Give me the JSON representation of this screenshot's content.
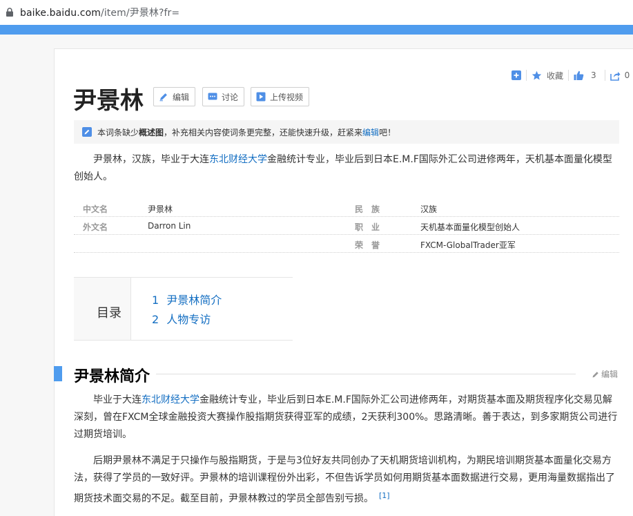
{
  "browser": {
    "url_host": "baike.baidu.com",
    "url_path": "/item/尹景林?fr="
  },
  "toolbar": {
    "collect_label": "收藏",
    "like_count": "3",
    "share_count": "0"
  },
  "title": {
    "name": "尹景林",
    "edit_label": "编辑",
    "discuss_label": "讨论",
    "upload_label": "上传视频"
  },
  "notice": {
    "prefix": "本词条缺少",
    "missing": "概述图",
    "middle": "，补充相关内容使词条更完整，还能快速升级，赶紧来",
    "link": "编辑",
    "suffix": "吧！"
  },
  "summary": {
    "part1": "尹景林，汉族，毕业于大连",
    "link": "东北财经大学",
    "part2": "金融统计专业，毕业后到日本E.M.F国际外汇公司进修两年，天机基本面量化模型创始人。"
  },
  "basic_info": [
    {
      "left_label": "中文名",
      "left_value": "尹景林",
      "right_label": "民　族",
      "right_value": "汉族"
    },
    {
      "left_label": "外文名",
      "left_value": "Darron Lin",
      "right_label": "职　业",
      "right_value": "天机基本面量化模型创始人"
    },
    {
      "left_label": "",
      "left_value": "",
      "right_label": "荣　誉",
      "right_value": "FXCM-GlobalTrader亚军"
    }
  ],
  "toc": {
    "label": "目录",
    "items": [
      {
        "num": "1",
        "text": "尹景林简介"
      },
      {
        "num": "2",
        "text": "人物专访"
      }
    ]
  },
  "section1": {
    "title": "尹景林简介",
    "edit_label": "编辑",
    "p1_part1": "毕业于大连",
    "p1_link": "东北财经大学",
    "p1_part2": "金融统计专业，毕业后到日本E.M.F国际外汇公司进修两年，对期货基本面及期货程序化交易见解深刻，曾在FXCM全球金融投资大赛操作股指期货获得亚军的成绩，2天获利300%。思路清晰。善于表达，到多家期货公司进行过期货培训。",
    "p2": "后期尹景林不满足于只操作与股指期货，于是与3位好友共同创办了天机期货培训机构，为期民培训期货基本面量化交易方法，获得了学员的一致好评。尹景林的培训课程份外出彩，不但告诉学员如何用期货基本面数据进行交易，更用海量数据指出了期货技术面交易的不足。截至目前，尹景林教过的学员全部告别亏损。",
    "ref": "[1]"
  }
}
